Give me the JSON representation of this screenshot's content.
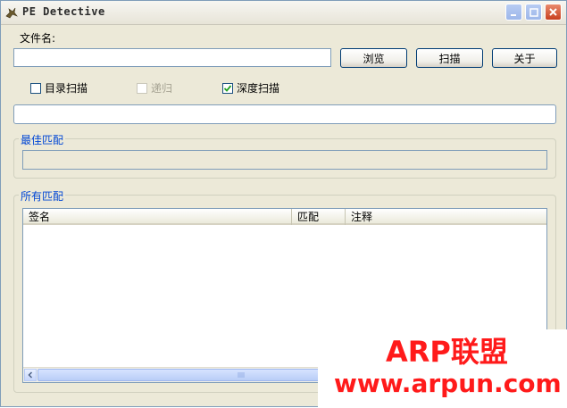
{
  "window": {
    "title": "PE Detective",
    "buttons": [
      "minimize",
      "maximize",
      "close"
    ]
  },
  "file": {
    "label": "文件名:",
    "value": ""
  },
  "toolbar": {
    "browse_label": "浏览",
    "scan_label": "扫描",
    "about_label": "关于"
  },
  "options": {
    "dir_scan": {
      "label": "目录扫描",
      "checked": false,
      "enabled": true
    },
    "recursive": {
      "label": "递归",
      "checked": false,
      "enabled": false
    },
    "deep_scan": {
      "label": "深度扫描",
      "checked": true,
      "enabled": true
    }
  },
  "progress": {
    "value": ""
  },
  "best_match": {
    "title": "最佳匹配",
    "value": ""
  },
  "all_matches": {
    "title": "所有匹配",
    "columns": [
      "签名",
      "匹配",
      "注释"
    ],
    "rows": []
  },
  "watermark": {
    "line1": "ARP联盟",
    "line2": "www.arpun.com"
  },
  "colors": {
    "accent": "#0046d5",
    "window_bg": "#ece9d8",
    "watermark": "#ff1a1a"
  }
}
